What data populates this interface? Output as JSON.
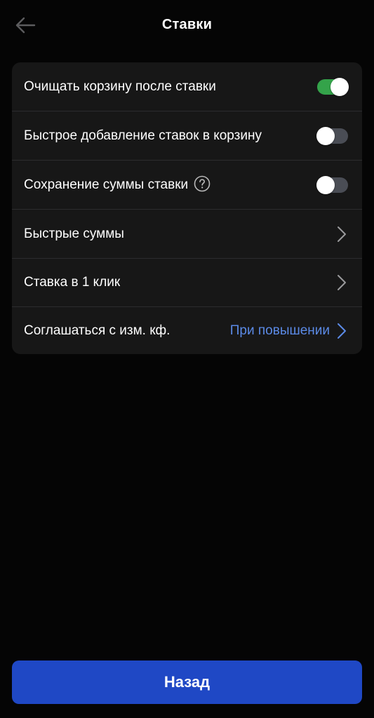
{
  "header": {
    "title": "Ставки",
    "back_icon": "arrow-left-icon"
  },
  "settings": {
    "clear_cart": {
      "label": "Очищать корзину после ставки",
      "enabled": true
    },
    "quick_add": {
      "label": "Быстрое добавление ставок в корзину",
      "enabled": false
    },
    "save_amount": {
      "label": "Сохранение суммы ставки",
      "enabled": false,
      "help_icon": "question-circle-icon"
    },
    "quick_amounts": {
      "label": "Быстрые суммы",
      "icon": "chevron-right-icon"
    },
    "one_click": {
      "label": "Ставка в 1 клик",
      "icon": "chevron-right-icon"
    },
    "accept_odds": {
      "label": "Соглашаться с изм. кф.",
      "value": "При повышении",
      "icon": "chevron-right-icon"
    }
  },
  "footer": {
    "back_label": "Назад"
  },
  "colors": {
    "background": "#050505",
    "card": "#171717",
    "toggle_on": "#34a34a",
    "toggle_off": "#4a4d55",
    "accent_link": "#5b8ae6",
    "primary_button": "#1f48c5"
  }
}
